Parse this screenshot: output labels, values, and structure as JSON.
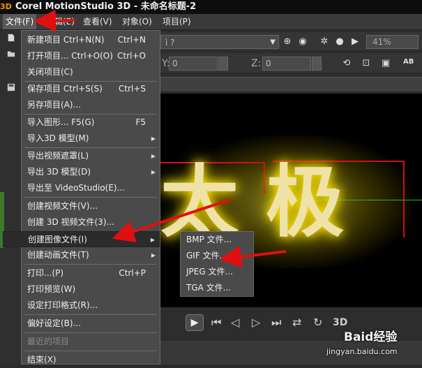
{
  "app": {
    "logo": "3D",
    "title": "Corel MotionStudio 3D - 未命名标题-2"
  },
  "menubar": [
    {
      "label": "文件(F)",
      "active": true
    },
    {
      "label": "编辑(E)",
      "active": false
    },
    {
      "label": "查看(V)",
      "active": false
    },
    {
      "label": "对象(O)",
      "active": false
    },
    {
      "label": "项目(P)",
      "active": false
    }
  ],
  "toolbar": {
    "combo_value": "ì ?",
    "zoom_value": "41%",
    "y_label": "Y:",
    "y_value": "0",
    "z_label": "Z:",
    "z_value": "0",
    "ab_label": "AB"
  },
  "file_menu": {
    "new_project": {
      "label": "新建项目 Ctrl+N(N)",
      "shortcut": "Ctrl+N"
    },
    "open_project": {
      "label": "打开项目... Ctrl+O(O)",
      "shortcut": "Ctrl+O"
    },
    "close_project": {
      "label": "关闭项目(C)"
    },
    "save_project": {
      "label": "保存项目 Ctrl+S(S)",
      "shortcut": "Ctrl+S"
    },
    "save_as": {
      "label": "另存项目(A)..."
    },
    "import_graphic": {
      "label": "导入图形... F5(G)",
      "shortcut": "F5"
    },
    "import_3d_model": {
      "label": "导入3D 模型(M)"
    },
    "export_video_mask": {
      "label": "导出视频遮罩(L)"
    },
    "export_3d_model": {
      "label": "导出 3D 模型(D)"
    },
    "export_to_videostudio": {
      "label": "导出至 VideoStudio(E)..."
    },
    "create_video_file": {
      "label": "创建视频文件(V)..."
    },
    "create_3d_video_file": {
      "label": "创建 3D 视频文件(3)..."
    },
    "create_image_file": {
      "label": "创建图像文件(I)"
    },
    "create_animation_file": {
      "label": "创建动画文件(T)"
    },
    "print": {
      "label": "打印...(P)",
      "shortcut": "Ctrl+P"
    },
    "print_preview": {
      "label": "打印预览(W)"
    },
    "print_setup": {
      "label": "设定打印格式(R)..."
    },
    "preferences": {
      "label": "偏好设定(B)..."
    },
    "recent_projects": {
      "label": "最近的项目"
    },
    "exit": {
      "label": "结束(X)"
    }
  },
  "image_submenu": [
    {
      "label": "BMP 文件..."
    },
    {
      "label": "GIF 文件..."
    },
    {
      "label": "JPEG 文件..."
    },
    {
      "label": "TGA 文件..."
    }
  ],
  "canvas": {
    "text": "太 极"
  },
  "transport": {
    "mode_label": "3D"
  },
  "watermark": {
    "line1": "Baid经验",
    "line2": "jingyan.baidu.com"
  },
  "colors": {
    "glow": "#ffe500",
    "text": "#efe2a8",
    "arrow": "#e01010",
    "menu_bg": "#4a4a4a",
    "highlight_bg": "#2b2b2b"
  }
}
